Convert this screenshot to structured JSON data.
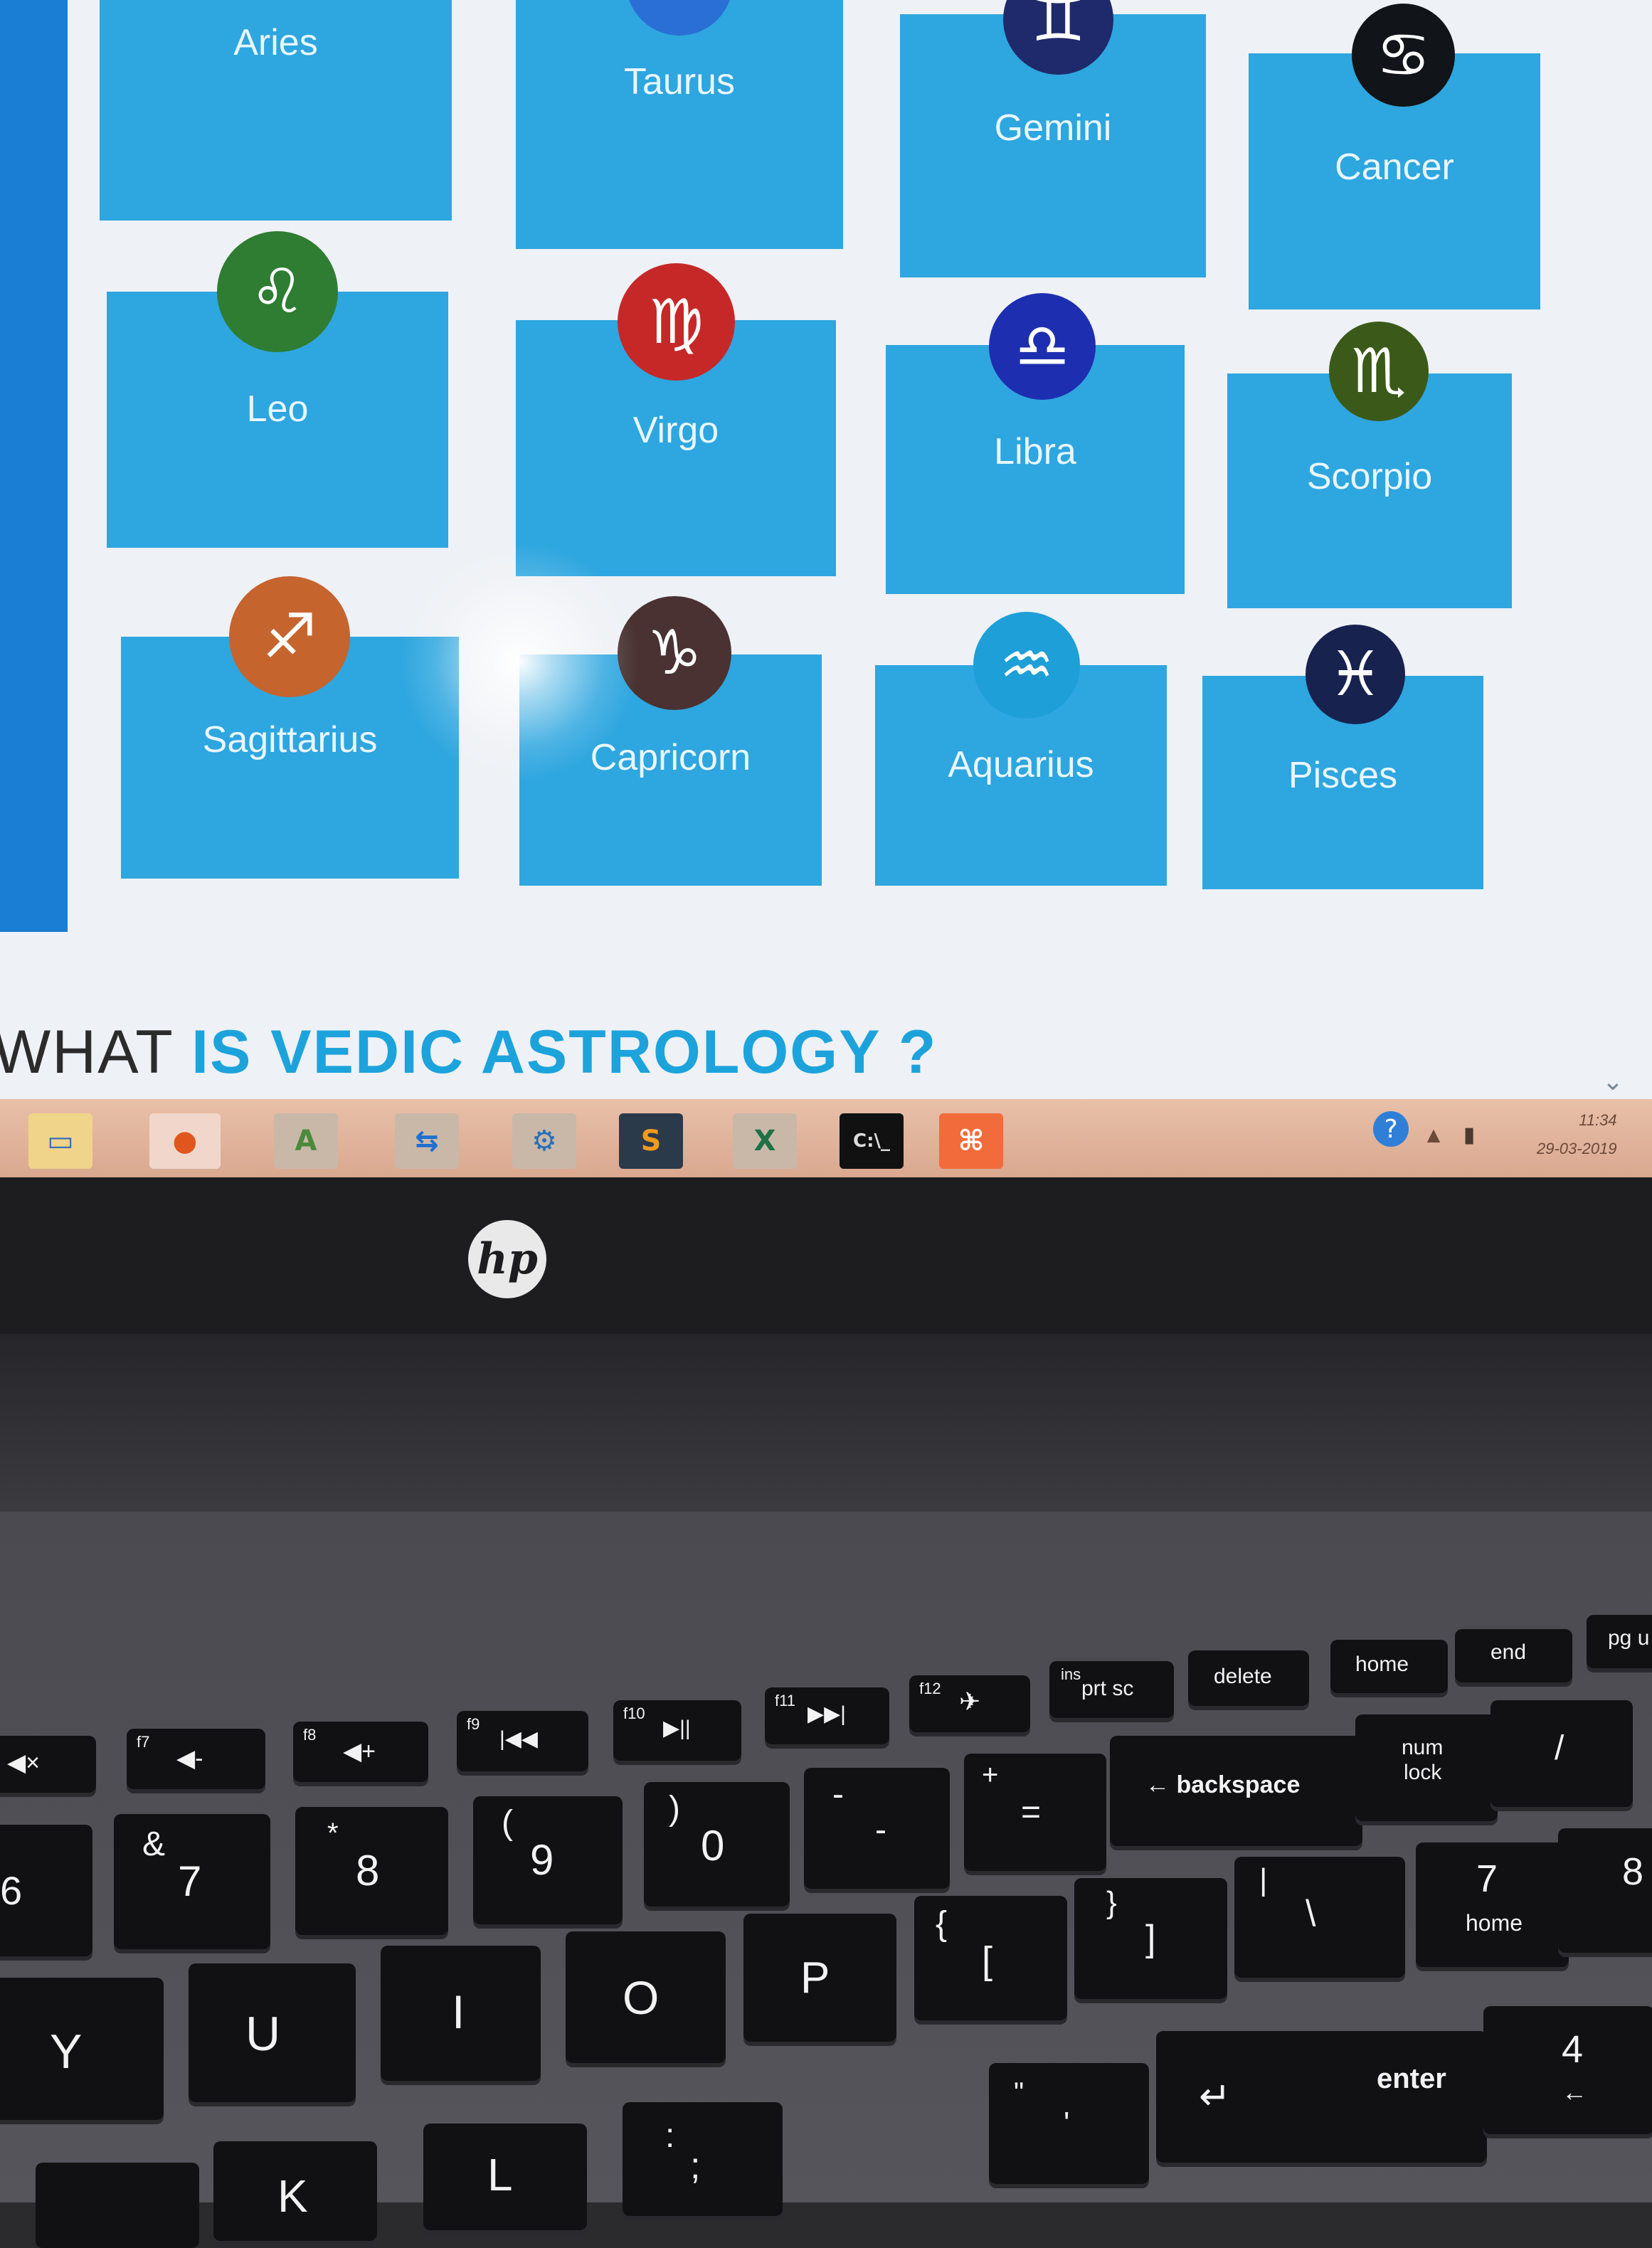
{
  "signs": [
    {
      "name": "Aries",
      "symbol": "♈",
      "color": "#c0392b"
    },
    {
      "name": "Taurus",
      "symbol": "♉",
      "color": "#2a6fd6"
    },
    {
      "name": "Gemini",
      "symbol": "♊",
      "color": "#1e2a6b"
    },
    {
      "name": "Cancer",
      "symbol": "♋",
      "color": "#111418"
    },
    {
      "name": "Leo",
      "symbol": "♌",
      "color": "#2e7d32"
    },
    {
      "name": "Virgo",
      "symbol": "♍",
      "color": "#c62828"
    },
    {
      "name": "Libra",
      "symbol": "♎",
      "color": "#1d2fb0"
    },
    {
      "name": "Scorpio",
      "symbol": "♏",
      "color": "#3b5a1a"
    },
    {
      "name": "Sagittarius",
      "symbol": "♐",
      "color": "#c6642e"
    },
    {
      "name": "Capricorn",
      "symbol": "♑",
      "color": "#4a3232"
    },
    {
      "name": "Aquarius",
      "symbol": "♒",
      "color": "#1e9fd8"
    },
    {
      "name": "Pisces",
      "symbol": "♓",
      "color": "#17224f"
    }
  ],
  "heading": {
    "part1": "WHAT ",
    "part2": "IS VEDIC ASTROLOGY ?"
  },
  "taskbar": {
    "time": "11:34",
    "date": "29-03-2019",
    "help": "?"
  },
  "brand": {
    "logo": "hp"
  },
  "keys": {
    "f7": "f7",
    "f8": "f8",
    "f9": "f9",
    "f10": "f10",
    "f11": "f11",
    "f12": "f12",
    "ins": "ins",
    "prt_sc": "prt sc",
    "delete": "delete",
    "home": "home",
    "end": "end",
    "pg_up": "pg u",
    "amp": "&",
    "seven": "7",
    "star": "*",
    "eight": "8",
    "lparen": "(",
    "nine": "9",
    "rparen": ")",
    "zero": "0",
    "minus": "-",
    "plus": "+",
    "equals": "=",
    "backspace": "← backspace",
    "num": "num",
    "lock": "lock",
    "slash": "/",
    "six": "6",
    "Y": "Y",
    "U": "U",
    "I": "I",
    "O": "O",
    "P": "P",
    "lbrace": "{",
    "lbracket": "[",
    "rbrace": "}",
    "rbracket": "]",
    "pipe": "|",
    "backslash": "\\",
    "numpad7": "7",
    "numpad7_sub": "home",
    "numpad8": "8",
    "K": "K",
    "L": "L",
    "colon": ":",
    "semicolon": ";",
    "quote": "\"",
    "apostrophe": "'",
    "enter": "enter",
    "enter_arrow": "↵",
    "numpad4": "4",
    "numpad4_sub": "←"
  }
}
